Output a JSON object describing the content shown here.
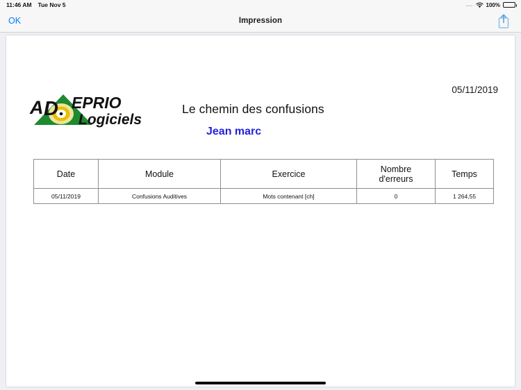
{
  "status_bar": {
    "time": "11:46 AM",
    "date": "Tue Nov 5",
    "dots": "....",
    "wifi_icon": "wifi-icon",
    "battery_percent": "100%",
    "battery_icon": "battery-full-icon"
  },
  "nav_bar": {
    "ok_label": "OK",
    "title": "Impression",
    "share_icon": "share-icon"
  },
  "document": {
    "date": "05/11/2019",
    "title": "Le chemin des confusions",
    "user_name": "Jean marc",
    "logo": {
      "icon": "adeprio-logo-icon",
      "brand": "ADEPRIO",
      "tagline": "Logiciels",
      "triangle_color": "#1f8a2e",
      "disc_color": "#e8c100"
    },
    "table": {
      "headers": [
        "Date",
        "Module",
        "Exercice",
        "Nombre d'erreurs",
        "Temps"
      ],
      "headers_wrapped": [
        [
          "Date"
        ],
        [
          "Module"
        ],
        [
          "Exercice"
        ],
        [
          "Nombre",
          "d'erreurs"
        ],
        [
          "Temps"
        ]
      ],
      "rows": [
        {
          "date": "05/11/2019",
          "module": "Confusions Auditives",
          "exercice": "Mots contenant [ch]",
          "nombre_erreurs": "0",
          "temps": "1 264,55"
        }
      ]
    }
  },
  "home_indicator": "home-indicator"
}
